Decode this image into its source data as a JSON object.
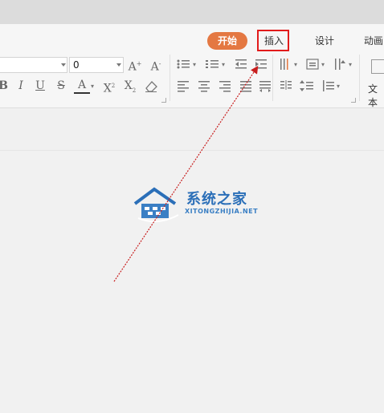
{
  "ribbon": {
    "tabs": [
      {
        "label": "开始",
        "active": true
      },
      {
        "label": "插入",
        "active": false,
        "highlighted": true
      },
      {
        "label": "设计",
        "active": false
      },
      {
        "label": "动画",
        "active": false
      }
    ],
    "font_name_value": "",
    "font_size_value": "0",
    "text_box_label": "文本"
  },
  "watermark": {
    "title": "系统之家",
    "subtitle": "XITONGZHIJIA.NET"
  },
  "colors": {
    "active_tab": "#e47842",
    "highlight_box": "#e21b1b",
    "arrow": "#c81e1e",
    "logo_blue": "#2b6fb8"
  }
}
